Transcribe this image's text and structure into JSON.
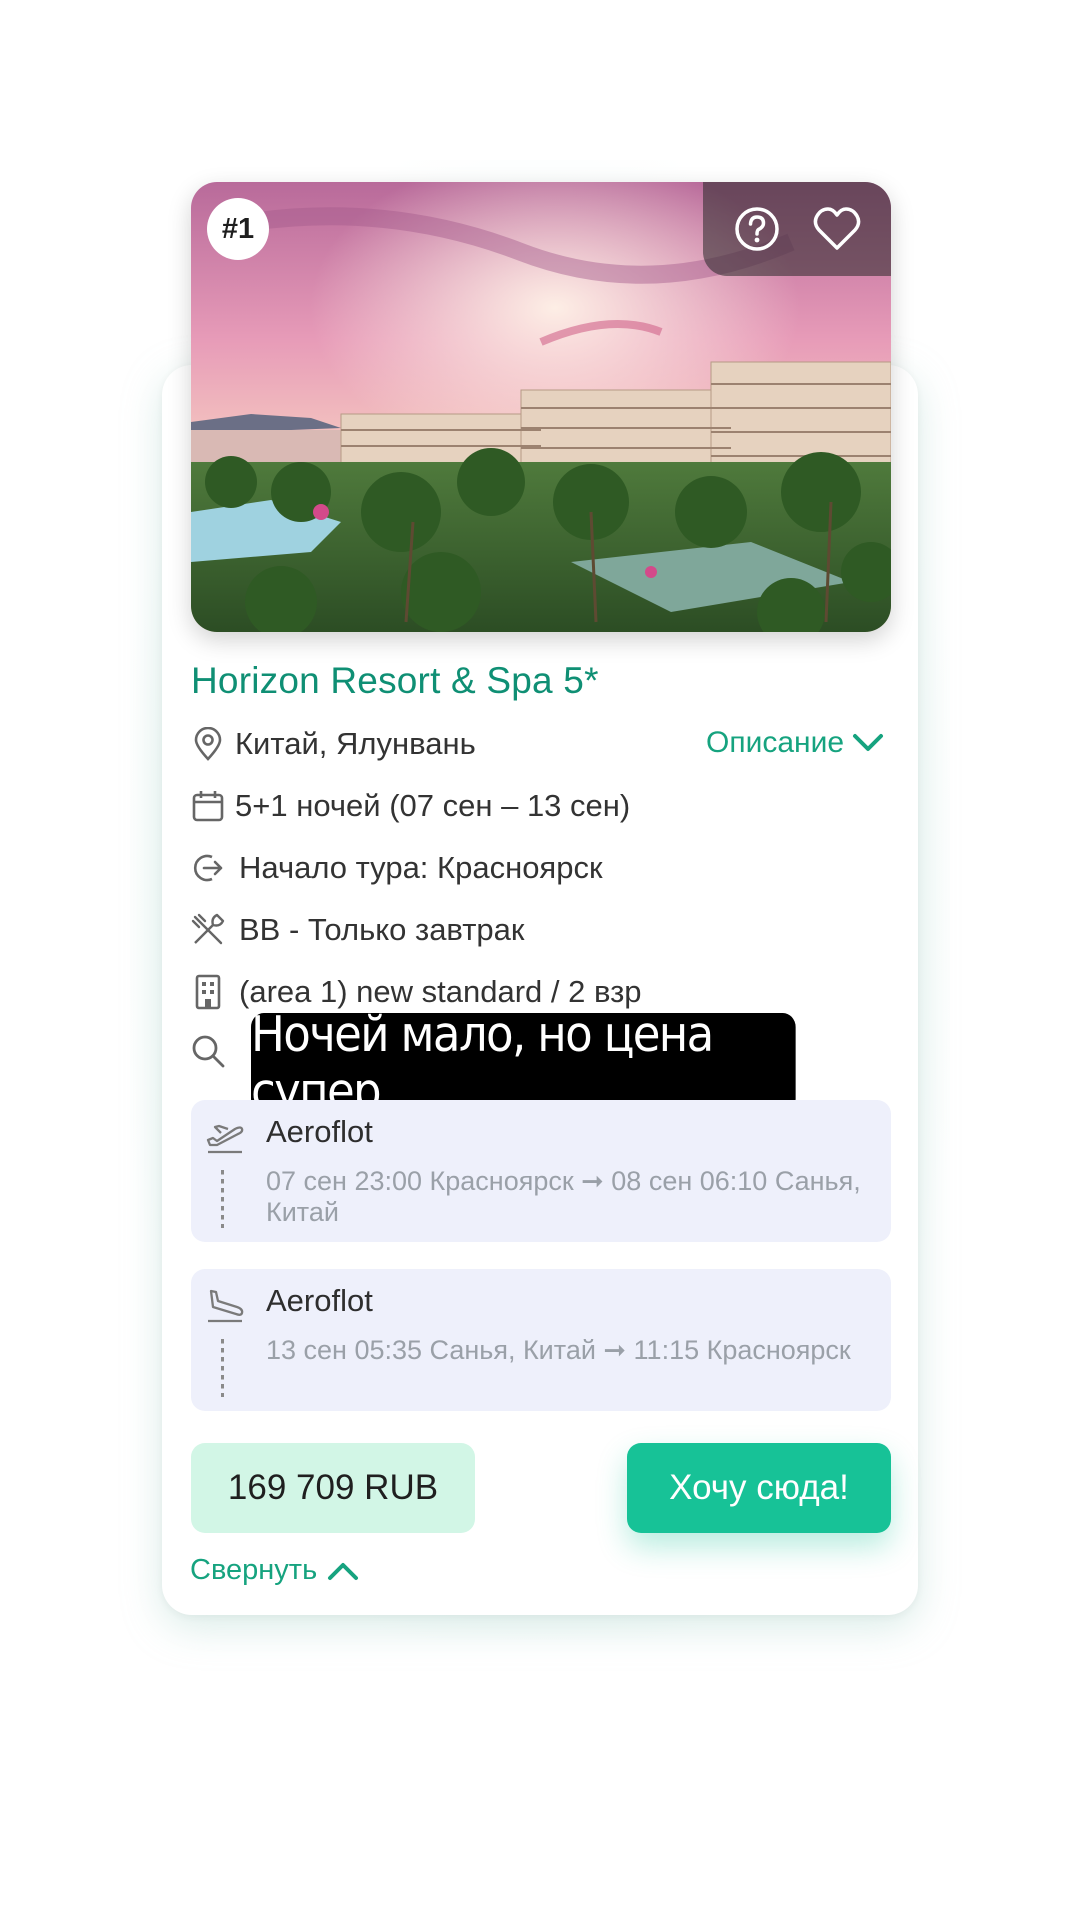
{
  "hotel": {
    "rank": "#1",
    "name": "Horizon Resort & Spa 5*",
    "location": "Китай, Ялунвань",
    "description_link": "Описание",
    "dates": "5+1 ночей (07 сен – 13 сен)",
    "tour_start": "Начало тура: Красноярск",
    "meal": "BB - Только завтрак",
    "room": "(area 1) new standard / 2 взр"
  },
  "overlay_caption": "Ночей мало, но цена супер",
  "flights": [
    {
      "airline": "Aeroflot",
      "route": "07 сен 23:00 Красноярск ➞ 08 сен 06:10 Санья, Китай",
      "icon": "plane-takeoff-icon"
    },
    {
      "airline": "Aeroflot",
      "route": "13 сен 05:35 Санья, Китай ➞ 11:15 Красноярск",
      "icon": "plane-landing-icon"
    }
  ],
  "price": "169 709 RUB",
  "cta_label": "Хочу сюда!",
  "collapse_label": "Свернуть",
  "colors": {
    "accent": "#17c297",
    "accent_text": "#0f8f74",
    "price_bg": "#d2f6e6",
    "flight_bg": "#eef0fb"
  }
}
